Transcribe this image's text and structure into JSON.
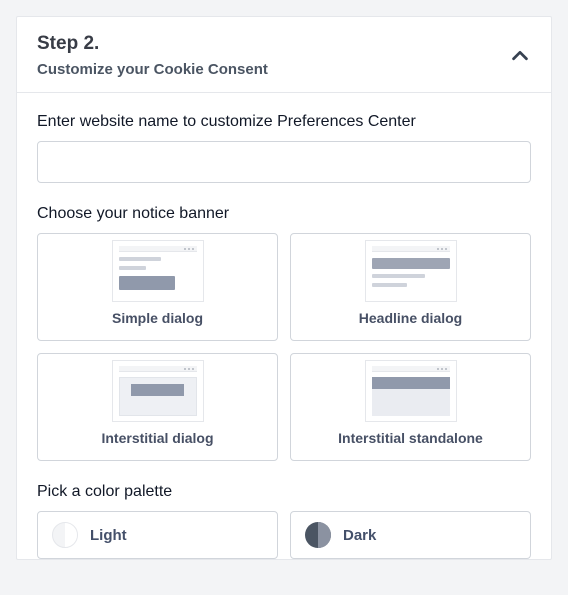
{
  "header": {
    "title": "Step 2.",
    "subtitle": "Customize your Cookie Consent"
  },
  "website_field": {
    "label": "Enter website name to customize Preferences Center",
    "value": "",
    "placeholder": ""
  },
  "banner_section": {
    "label": "Choose your notice banner",
    "options": [
      {
        "id": "simple-dialog",
        "label": "Simple dialog"
      },
      {
        "id": "headline-dialog",
        "label": "Headline dialog"
      },
      {
        "id": "interstitial-dialog",
        "label": "Interstitial dialog"
      },
      {
        "id": "interstitial-standalone",
        "label": "Interstitial standalone"
      }
    ]
  },
  "palette_section": {
    "label": "Pick a color palette",
    "options": [
      {
        "id": "light",
        "label": "Light"
      },
      {
        "id": "dark",
        "label": "Dark"
      }
    ]
  }
}
